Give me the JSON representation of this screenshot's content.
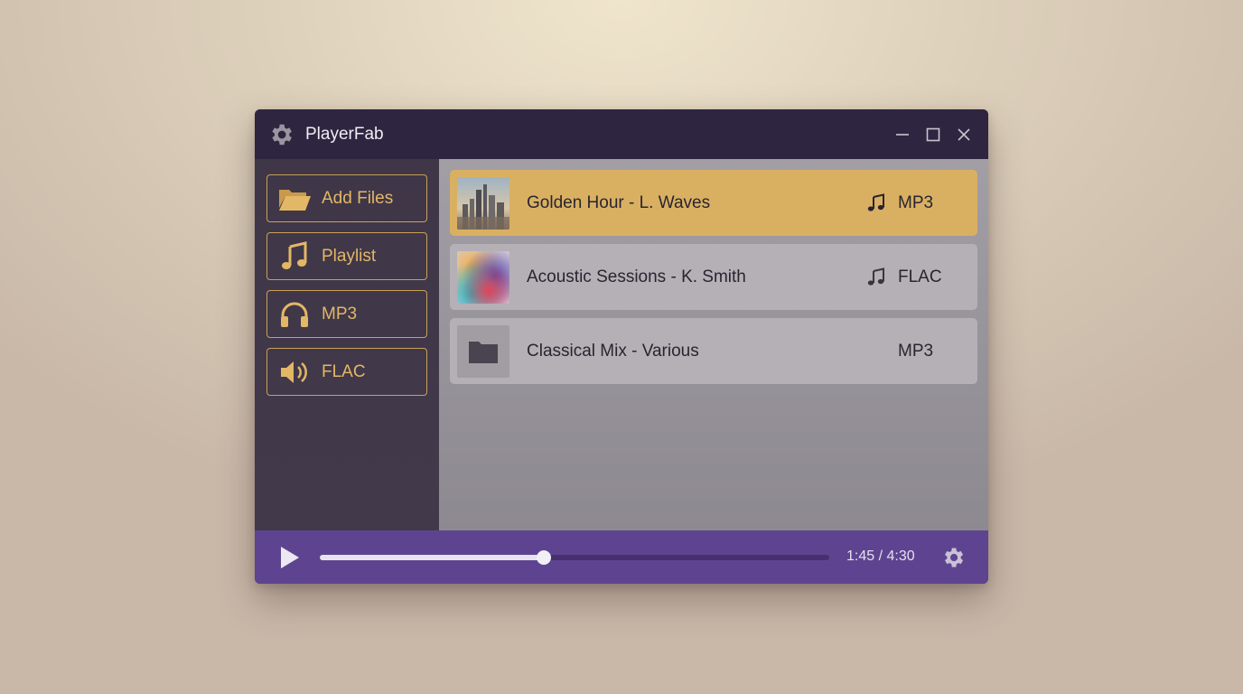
{
  "window": {
    "title": "PlayerFab",
    "icons": {
      "app": "gear-icon",
      "minimize": "minimize-icon",
      "maximize": "maximize-icon",
      "close": "close-icon"
    }
  },
  "sidebar": {
    "items": [
      {
        "label": "Add Files",
        "icon": "folder-open-icon"
      },
      {
        "label": "Playlist",
        "icon": "music-note-icon"
      },
      {
        "label": "MP3",
        "icon": "headphones-icon"
      },
      {
        "label": "FLAC",
        "icon": "speaker-icon"
      }
    ]
  },
  "tracks": [
    {
      "name": "Golden Hour - L. Waves",
      "format": "MP3",
      "selected": true,
      "thumbnail": "city-skyline-image",
      "icon": "music-note-icon"
    },
    {
      "name": "Acoustic Sessions - K. Smith",
      "format": "FLAC",
      "selected": false,
      "thumbnail": "abstract-color-image",
      "icon": "music-note-icon"
    },
    {
      "name": "Classical Mix - Various",
      "format": "MP3",
      "selected": false,
      "thumbnail": "folder-icon"
    }
  ],
  "player": {
    "time": "1:45 / 4:30",
    "progress": 0.44,
    "icons": {
      "play": "play-icon",
      "settings": "gear-icon"
    }
  },
  "colors": {
    "accent": "#d9b062",
    "sidebar_border": "#c9a15a",
    "controls_bar": "#5e4490",
    "titlebar": "#2e2640"
  }
}
